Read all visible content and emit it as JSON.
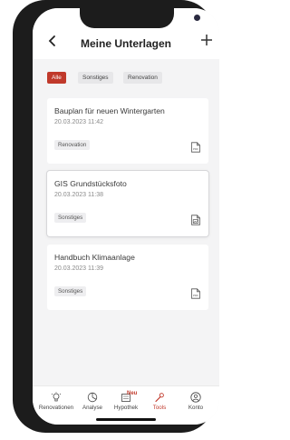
{
  "header": {
    "title": "Meine Unterlagen"
  },
  "filters": [
    {
      "label": "Alle",
      "active": true
    },
    {
      "label": "Sonstiges",
      "active": false
    },
    {
      "label": "Renovation",
      "active": false
    }
  ],
  "documents": [
    {
      "title": "Bauplan für neuen Wintergarten",
      "date": "20.03.2023 11:42",
      "tag": "Renovation",
      "file_icon": "pdf-file-icon"
    },
    {
      "title": "GIS Grundstücksfoto",
      "date": "20.03.2023 11:38",
      "tag": "Sonstiges",
      "file_icon": "image-file-icon"
    },
    {
      "title": "Handbuch Klimaanlage",
      "date": "20.03.2023 11:39",
      "tag": "Sonstiges",
      "file_icon": "pdf-file-icon"
    }
  ],
  "tabbar": {
    "items": [
      {
        "label": "Renovationen",
        "icon": "lightbulb-icon"
      },
      {
        "label": "Analyse",
        "icon": "pie-chart-icon"
      },
      {
        "label": "Hypothek",
        "icon": "calculator-icon",
        "badge": "Neu"
      },
      {
        "label": "Tools",
        "icon": "wrench-icon",
        "active": true
      },
      {
        "label": "Konto",
        "icon": "user-icon"
      }
    ]
  },
  "colors": {
    "accent": "#c0392b",
    "card_bg": "#ffffff",
    "screen_bg": "#f4f4f5"
  }
}
